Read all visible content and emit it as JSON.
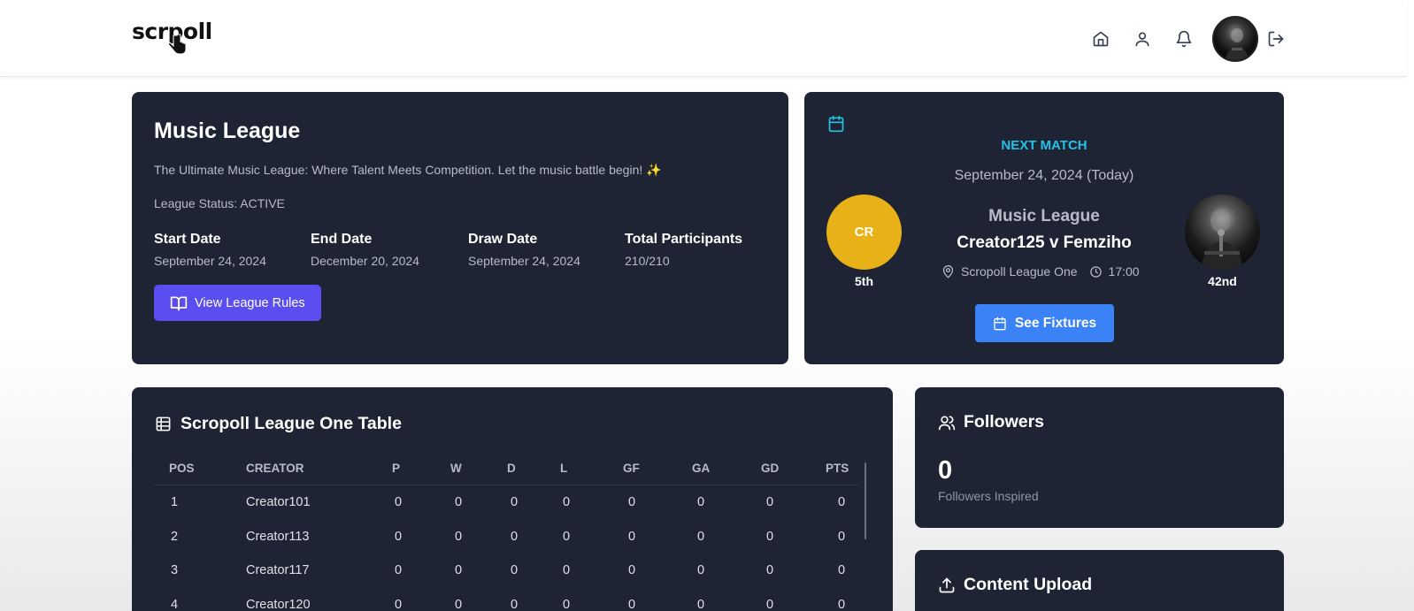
{
  "header": {
    "logo_text": "scrpoll",
    "nav_icons": [
      "home-icon",
      "user-icon",
      "bell-icon",
      "logout-icon"
    ]
  },
  "league": {
    "title": "Music League",
    "description": "The Ultimate Music League: Where Talent Meets Competition. Let the music battle begin! ✨",
    "status": "League Status: ACTIVE",
    "info": [
      {
        "label": "Start Date",
        "value": "September 24, 2024"
      },
      {
        "label": "End Date",
        "value": "December 20, 2024"
      },
      {
        "label": "Draw Date",
        "value": "September 24, 2024"
      },
      {
        "label": "Total Participants",
        "value": "210/210"
      }
    ],
    "rules_button": "View League Rules"
  },
  "match": {
    "heading": "NEXT MATCH",
    "date": "September 24, 2024 (Today)",
    "league": "Music League",
    "versus": "Creator125 v Femziho",
    "venue": "Scropoll League One",
    "time": "17:00",
    "home_initials": "CR",
    "home_rank": "5th",
    "away_rank": "42nd",
    "fixtures_button": "See Fixtures",
    "home_color": "#e8b118"
  },
  "table": {
    "title": "Scropoll League One Table",
    "columns": [
      "POS",
      "CREATOR",
      "P",
      "W",
      "D",
      "L",
      "GF",
      "GA",
      "GD",
      "PTS"
    ],
    "rows": [
      [
        "1",
        "Creator101",
        "0",
        "0",
        "0",
        "0",
        "0",
        "0",
        "0",
        "0"
      ],
      [
        "2",
        "Creator113",
        "0",
        "0",
        "0",
        "0",
        "0",
        "0",
        "0",
        "0"
      ],
      [
        "3",
        "Creator117",
        "0",
        "0",
        "0",
        "0",
        "0",
        "0",
        "0",
        "0"
      ],
      [
        "4",
        "Creator120",
        "0",
        "0",
        "0",
        "0",
        "0",
        "0",
        "0",
        "0"
      ]
    ]
  },
  "followers": {
    "title": "Followers",
    "count": "0",
    "subtitle": "Followers Inspired"
  },
  "upload": {
    "title": "Content Upload"
  },
  "colors": {
    "card_bg": "#1e2433",
    "accent_purple": "#5b4ef0",
    "accent_blue": "#3b82f6",
    "accent_cyan": "#22c3e6"
  }
}
